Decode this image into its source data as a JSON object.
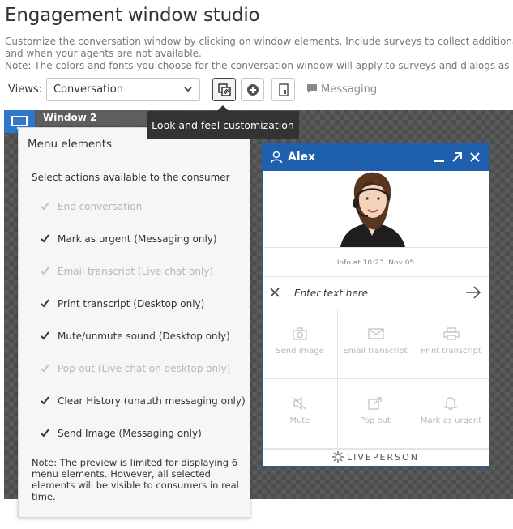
{
  "page": {
    "title": "Engagement window studio",
    "description_line1": "Customize the conversation window by clicking on window elements. Include surveys to collect additional information",
    "description_line2": "and when your agents are not available.",
    "description_line3": "Note: The colors and fonts you choose for the conversation window will apply to surveys and dialogs as well."
  },
  "toolbar": {
    "views_label": "Views:",
    "views_selected": "Conversation",
    "messaging_label": "Messaging",
    "tooltip": "Look and feel customization"
  },
  "preview": {
    "window_tab": "Window 2"
  },
  "menu_panel": {
    "title": "Menu elements",
    "subtitle": "Select actions available to the consumer",
    "items": [
      {
        "label": "End conversation",
        "checked": true,
        "disabled": true
      },
      {
        "label": "Mark as urgent (Messaging only)",
        "checked": true,
        "disabled": false
      },
      {
        "label": "Email transcript (Live chat only)",
        "checked": true,
        "disabled": true
      },
      {
        "label": "Print transcript (Desktop only)",
        "checked": true,
        "disabled": false
      },
      {
        "label": "Mute/unmute sound (Desktop only)",
        "checked": true,
        "disabled": false
      },
      {
        "label": "Pop-out (Live chat on desktop only)",
        "checked": true,
        "disabled": true
      },
      {
        "label": "Clear History (unauth messaging only)",
        "checked": true,
        "disabled": false
      },
      {
        "label": "Send Image (Messaging only)",
        "checked": true,
        "disabled": false
      }
    ],
    "note": "Note: The preview is limited for displaying 6 menu elements. However, all selected elements will be visible to consumers in real time."
  },
  "chat_window": {
    "agent_name": "Alex",
    "timestamp": "Info at 10:23, Nov 05",
    "input_placeholder": "Enter text here",
    "header_color": "#1e5fae",
    "grid": [
      {
        "label": "Send image",
        "icon": "camera-icon"
      },
      {
        "label": "Email transcript",
        "icon": "envelope-icon"
      },
      {
        "label": "Print transcript",
        "icon": "printer-icon"
      },
      {
        "label": "Mute",
        "icon": "speaker-mute-icon"
      },
      {
        "label": "Pop out",
        "icon": "popout-icon"
      },
      {
        "label": "Mark as urgent",
        "icon": "bell-icon"
      }
    ],
    "footer_brand": "LIVEPERSON"
  }
}
